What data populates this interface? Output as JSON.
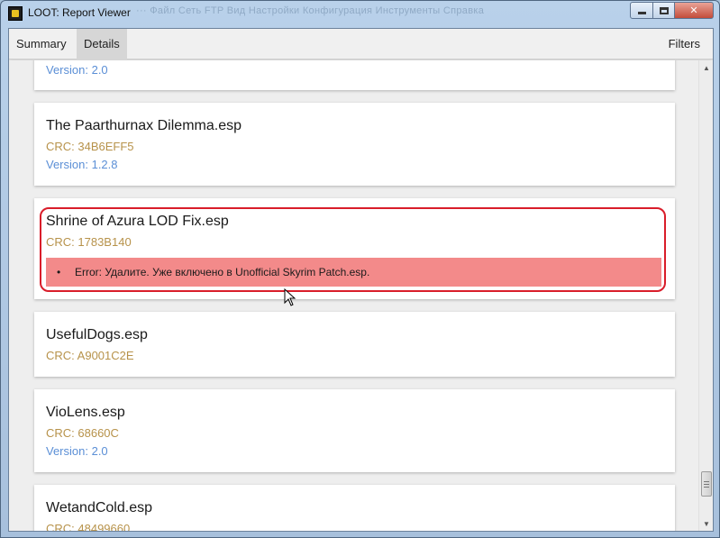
{
  "window": {
    "title": "LOOT: Report Viewer",
    "background_menu": "···  Файл   Сеть   FTP   Вид   Настройки   Конфигурация   Инструменты   Справка",
    "close_glyph": "✕"
  },
  "toolbar": {
    "tabs": [
      {
        "label": "Summary",
        "active": false
      },
      {
        "label": "Details",
        "active": true
      }
    ],
    "filters_label": "Filters"
  },
  "plugins": [
    {
      "name": "",
      "crc": "",
      "version": "Version: 2.0"
    },
    {
      "name": "The Paarthurnax Dilemma.esp",
      "crc": "CRC: 34B6EFF5",
      "version": "Version: 1.2.8"
    },
    {
      "name": "Shrine of Azura LOD Fix.esp",
      "crc": "CRC: 1783B140",
      "version": "",
      "message": "Error: Удалите. Уже включено в Unofficial Skyrim Patch.esp.",
      "highlighted": true
    },
    {
      "name": "UsefulDogs.esp",
      "crc": "CRC: A9001C2E",
      "version": ""
    },
    {
      "name": "VioLens.esp",
      "crc": "CRC: 68660C",
      "version": "Version: 2.0"
    },
    {
      "name": "WetandCold.esp",
      "crc": "CRC: 48499660",
      "version": ""
    }
  ],
  "scrollbar": {
    "up_glyph": "▲",
    "down_glyph": "▼"
  },
  "colors": {
    "crc": "#b7924a",
    "version": "#5b8fd6",
    "error_bg": "#f38a8a",
    "highlight_border": "#d91d2a"
  }
}
